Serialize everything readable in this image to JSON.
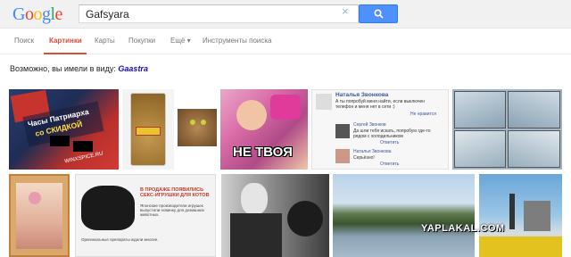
{
  "header": {
    "logo": [
      "G",
      "o",
      "o",
      "g",
      "l",
      "e"
    ],
    "logo_colors": [
      "#4285f4",
      "#ea4335",
      "#fbbc05",
      "#4285f4",
      "#34a853",
      "#ea4335"
    ],
    "query": "Gafsyara",
    "clear_glyph": "×"
  },
  "tabs": [
    {
      "label": "Поиск",
      "active": false
    },
    {
      "label": "Картинки",
      "active": true
    },
    {
      "label": "Карты",
      "active": false
    },
    {
      "label": "Покупки",
      "active": false
    },
    {
      "label": "Ещё ▾",
      "active": false
    },
    {
      "label": "Инструменты поиска",
      "active": false
    }
  ],
  "suggestion": {
    "prefix": "Возможно, вы имели в виду: ",
    "link": "Gaastra"
  },
  "images": {
    "watch_ad": {
      "line1": "Часы Патриарха",
      "line2": "со СКИДКОЙ",
      "site": "WINXSPICE.RU"
    },
    "meme": {
      "caption": "НЕ ТВОЯ"
    },
    "chat": {
      "name": "Наталья Звонкова",
      "msg1": "А ты попробуй меня найти, если выключен телефон и меня нет в сети :)",
      "link1": "Не нравится",
      "name2": "Сергей Звонков",
      "msg2": "Да шли тебя искать, попробую где-то рядом с холодильником",
      "name3": "Наталья Звонкова",
      "msg3": "Серьёзно!",
      "reply": "Ответить"
    },
    "toy_ad": {
      "title": "В ПРОДАЖЕ ПОЯВИЛИСЬ СЕКС-ИГРУШКИ ДЛЯ КОТОВ",
      "body": "Японские производители игрушек выпустили новинку для домашних животных.",
      "footer": "Оригинальные препараты ждали многие."
    },
    "watermark": "YAPLAKAL.COM"
  },
  "colors": {
    "accent": "#dd4b39",
    "link": "#1a0dab",
    "button": "#4d90fe"
  }
}
